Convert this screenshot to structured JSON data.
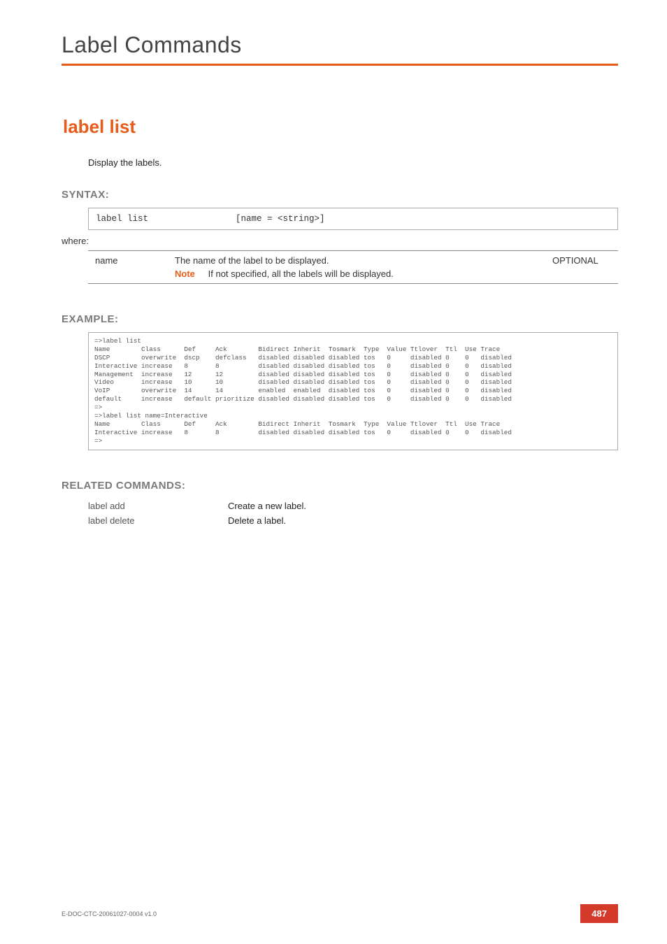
{
  "chapter": "Label Commands",
  "command_title": "label list",
  "description": "Display the labels.",
  "syntax_heading": "SYNTAX:",
  "syntax": {
    "command": "label list",
    "args": "[name = <string>]"
  },
  "where_label": "where:",
  "param": {
    "name": "name",
    "desc_line1": "The name of the label to be displayed.",
    "note_label": "Note",
    "note_text": "If not specified, all the labels will be displayed.",
    "optional": "OPTIONAL"
  },
  "example_heading": "EXAMPLE:",
  "example_text": "=>label list\nName        Class      Def     Ack        Bidirect Inherit  Tosmark  Type  Value Ttlover  Ttl  Use Trace\nDSCP        overwrite  dscp    defclass   disabled disabled disabled tos   0     disabled 0    0   disabled\nInteractive increase   8       8          disabled disabled disabled tos   0     disabled 0    0   disabled\nManagement  increase   12      12         disabled disabled disabled tos   0     disabled 0    0   disabled\nVideo       increase   10      10         disabled disabled disabled tos   0     disabled 0    0   disabled\nVoIP        overwrite  14      14         enabled  enabled  disabled tos   0     disabled 0    0   disabled\ndefault     increase   default prioritize disabled disabled disabled tos   0     disabled 0    0   disabled\n=>\n=>label list name=Interactive\nName        Class      Def     Ack        Bidirect Inherit  Tosmark  Type  Value Ttlover  Ttl  Use Trace\nInteractive increase   8       8          disabled disabled disabled tos   0     disabled 0    0   disabled\n=>",
  "related_heading": "RELATED COMMANDS:",
  "related": [
    {
      "cmd": "label add",
      "desc": "Create a new label."
    },
    {
      "cmd": "label delete",
      "desc": "Delete a label."
    }
  ],
  "footer": {
    "doc_id": "E-DOC-CTC-20061027-0004 v1.0",
    "page": "487"
  }
}
